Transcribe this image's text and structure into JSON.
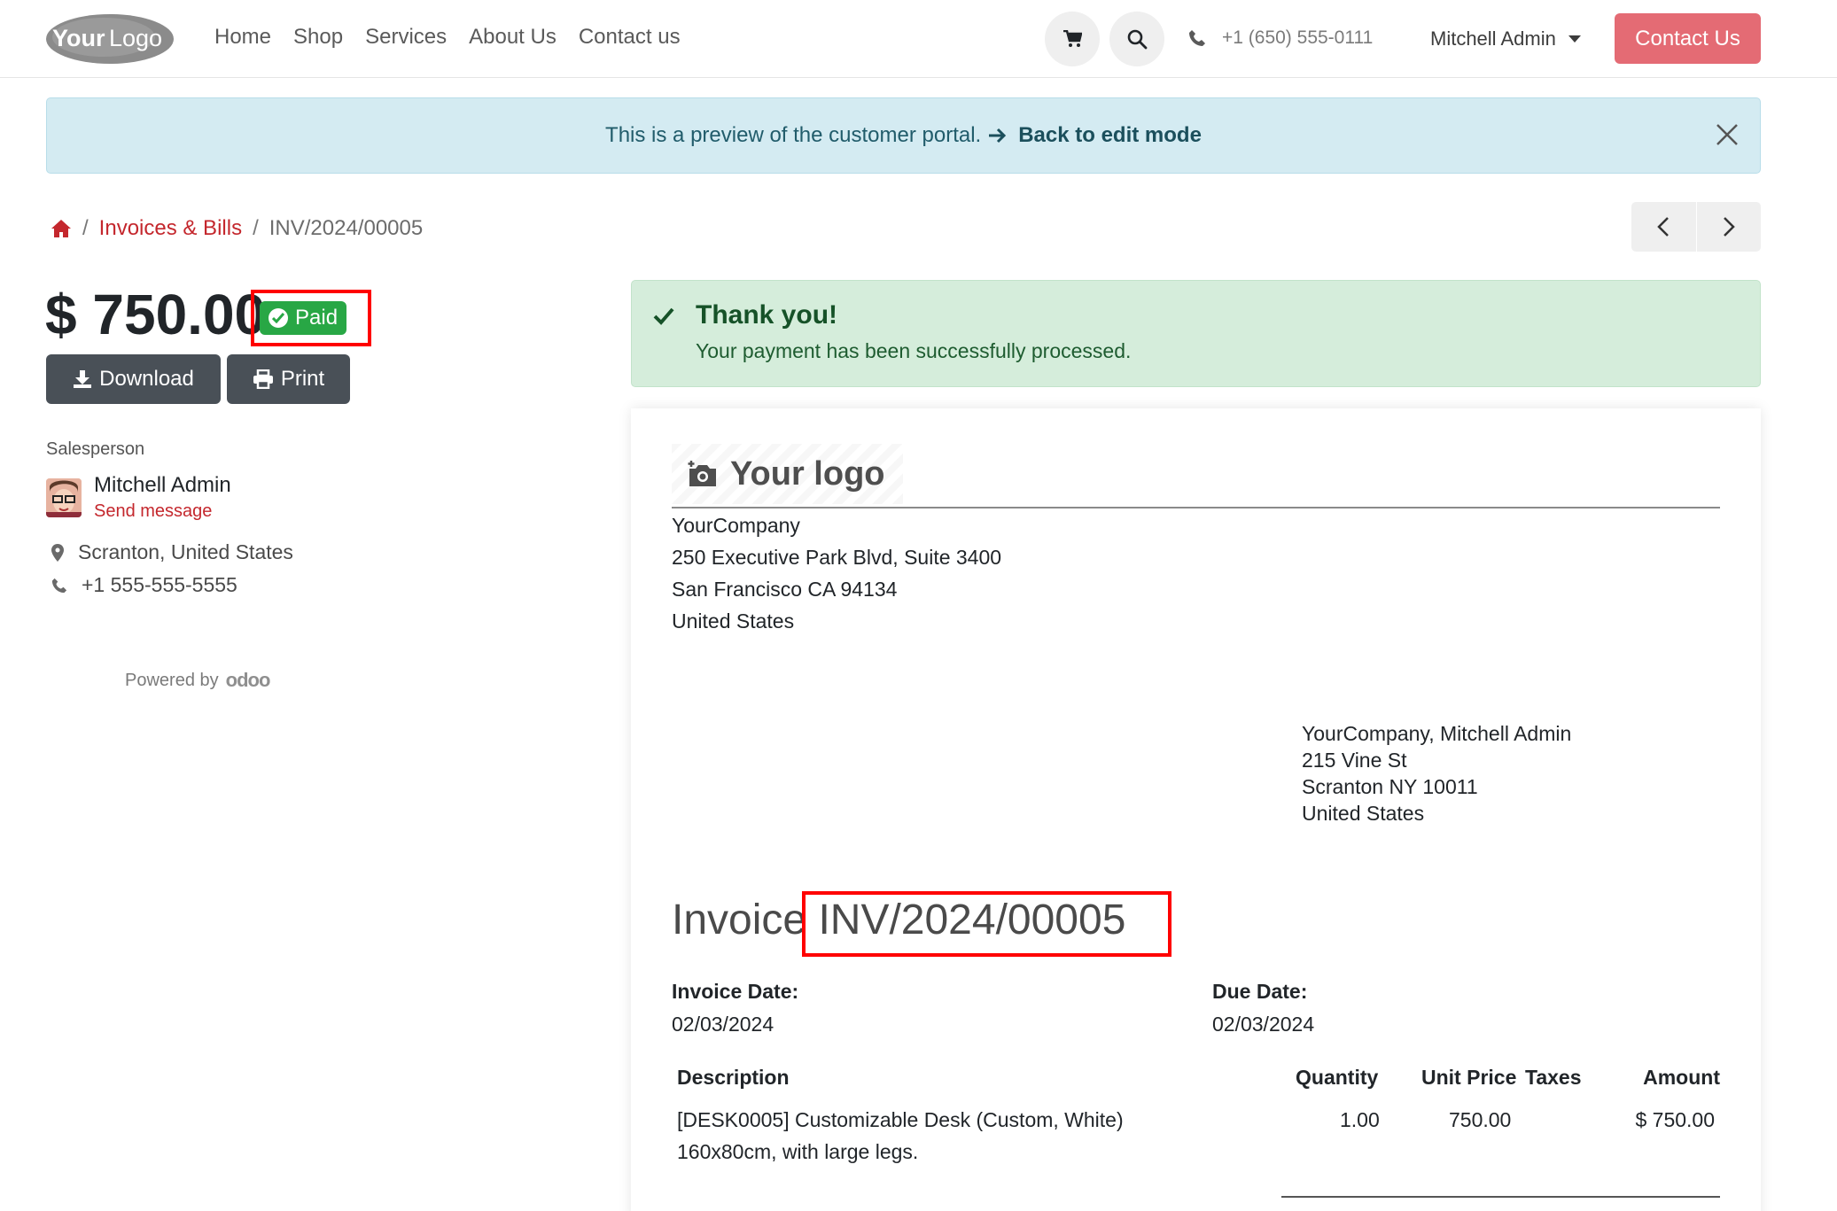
{
  "nav": {
    "logo_text": "YourLogo",
    "links": [
      "Home",
      "Shop",
      "Services",
      "About Us",
      "Contact us"
    ],
    "phone": "+1 (650) 555-0111",
    "user": "Mitchell Admin",
    "cta": "Contact Us"
  },
  "banner": {
    "text": "This is a preview of the customer portal.",
    "link": "Back to edit mode"
  },
  "breadcrumb": {
    "section": "Invoices & Bills",
    "current": "INV/2024/00005"
  },
  "summary": {
    "amount": "$ 750.00",
    "status": "Paid",
    "download_label": "Download",
    "print_label": "Print"
  },
  "salesperson": {
    "label": "Salesperson",
    "name": "Mitchell Admin",
    "send_message": "Send message",
    "location": "Scranton, United States",
    "phone": "+1 555-555-5555"
  },
  "footer": {
    "powered_by": "Powered by",
    "brand": "odoo"
  },
  "alert": {
    "title": "Thank you!",
    "message": "Your payment has been successfully processed."
  },
  "invoice": {
    "logo_text": "Your logo",
    "company": {
      "name": "YourCompany",
      "street": "250 Executive Park Blvd, Suite 3400",
      "city": "San Francisco CA 94134",
      "country": "United States"
    },
    "customer": {
      "name": "YourCompany, Mitchell Admin",
      "street": "215 Vine St",
      "city": "Scranton NY 10011",
      "country": "United States"
    },
    "title_prefix": "Invoice",
    "number": "INV/2024/00005",
    "invoice_date_label": "Invoice Date:",
    "invoice_date": "02/03/2024",
    "due_date_label": "Due Date:",
    "due_date": "02/03/2024",
    "columns": {
      "description": "Description",
      "quantity": "Quantity",
      "unit_price": "Unit Price",
      "taxes": "Taxes",
      "amount": "Amount"
    },
    "lines": [
      {
        "description": "[DESK0005] Customizable Desk (Custom, White)",
        "description_2": "160x80cm, with large legs.",
        "quantity": "1.00",
        "unit_price": "750.00",
        "taxes": "",
        "amount": "$ 750.00"
      }
    ]
  },
  "colors": {
    "accent": "#e46b74",
    "link": "#c4272d",
    "success": "#28a745",
    "banner_bg": "#d4ebf2",
    "alert_bg": "#d5eddb"
  }
}
